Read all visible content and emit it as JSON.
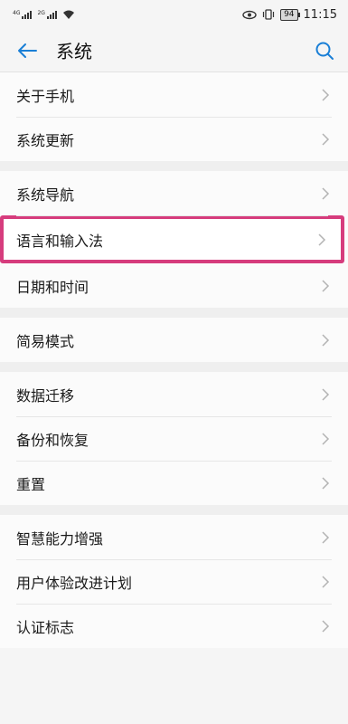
{
  "status_bar": {
    "net1": "4G",
    "net2": "2G",
    "battery": "94",
    "time": "11:15"
  },
  "app_bar": {
    "title": "系统",
    "icons": [
      "arrow-left-icon",
      "search-icon"
    ]
  },
  "colors": {
    "accent": "#1a7fd6",
    "highlight_border": "#d63c7d"
  },
  "groups": [
    {
      "items": [
        {
          "label": "关于手机"
        },
        {
          "label": "系统更新"
        }
      ]
    },
    {
      "items": [
        {
          "label": "系统导航"
        },
        {
          "label": "语言和输入法",
          "highlighted": true
        },
        {
          "label": "日期和时间"
        }
      ]
    },
    {
      "items": [
        {
          "label": "简易模式"
        }
      ]
    },
    {
      "items": [
        {
          "label": "数据迁移"
        },
        {
          "label": "备份和恢复"
        },
        {
          "label": "重置"
        }
      ]
    },
    {
      "items": [
        {
          "label": "智慧能力增强"
        },
        {
          "label": "用户体验改进计划"
        },
        {
          "label": "认证标志"
        }
      ]
    }
  ]
}
